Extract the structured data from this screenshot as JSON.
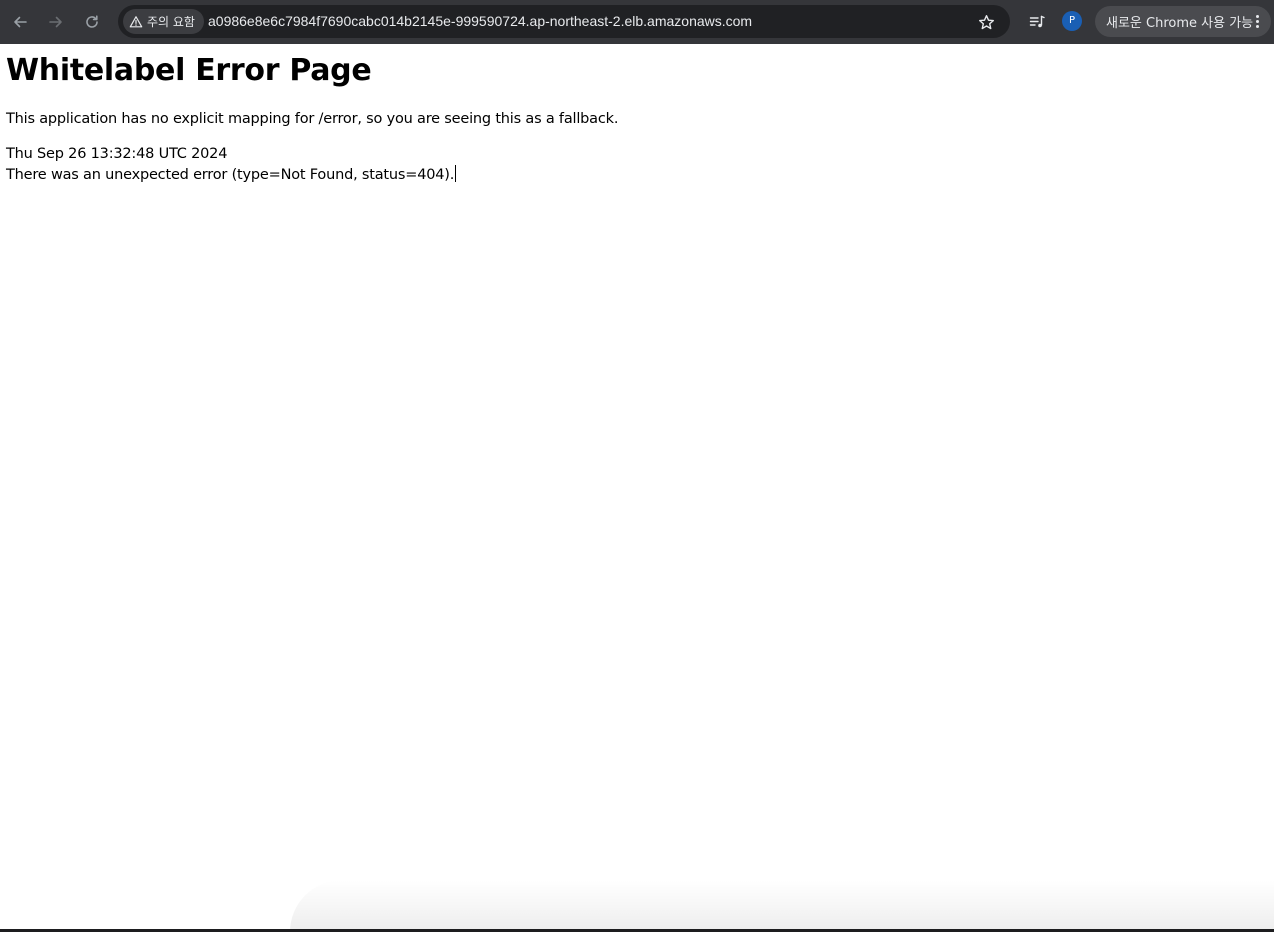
{
  "browser": {
    "security_label": "주의 요함",
    "url": "a0986e8e6c7984f7690cabc014b2145e-999590724.ap-northeast-2.elb.amazonaws.com",
    "profile_initial": "P",
    "update_label": "새로운 Chrome 사용 가능",
    "icons": {
      "back": "back-arrow-icon",
      "forward": "forward-arrow-icon",
      "reload": "reload-icon",
      "warning": "warning-triangle-icon",
      "bookmark": "star-icon",
      "media": "media-queue-icon",
      "menu": "more-vertical-icon"
    },
    "colors": {
      "toolbar_bg": "#35363a",
      "omnibox_bg": "#202124",
      "avatar_bg": "#1a5fb4"
    }
  },
  "page": {
    "title": "Whitelabel Error Page",
    "explanation": "This application has no explicit mapping for /error, so you are seeing this as a fallback.",
    "timestamp": "Thu Sep 26 13:32:48 UTC 2024",
    "error_detail": "There was an unexpected error (type=Not Found, status=404)."
  }
}
